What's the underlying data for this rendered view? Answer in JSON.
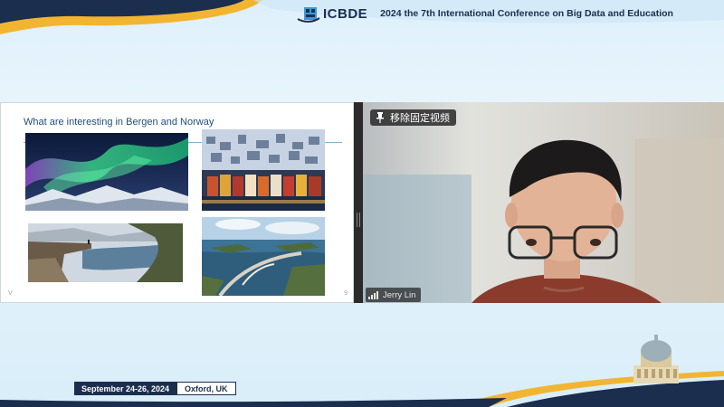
{
  "header": {
    "logo_text": "ICBDE",
    "conference_title": "2024 the 7th International Conference on Big Data and Education"
  },
  "slide": {
    "title": "What are interesting in Bergen and Norway",
    "photos": [
      {
        "subject": "aurora borealis over snowy mountains"
      },
      {
        "subject": "Bergen colorful houses at night"
      },
      {
        "subject": "Trolltunga cliff over fjord lake"
      },
      {
        "subject": "Atlantic Ocean Road bridge"
      }
    ],
    "corner_left": "V",
    "corner_right": "9"
  },
  "video": {
    "unpin_label": "移除固定视频",
    "participant_name": "Jerry Lin"
  },
  "footer": {
    "dates": "September 24-26, 2024",
    "location": "Oxford, UK"
  },
  "colors": {
    "navy": "#1b2e4e",
    "gold": "#f2b531",
    "slide_title": "#1f4e79"
  },
  "icons": [
    "logo-mark-icon",
    "pin-icon",
    "signal-icon",
    "building-icon"
  ]
}
